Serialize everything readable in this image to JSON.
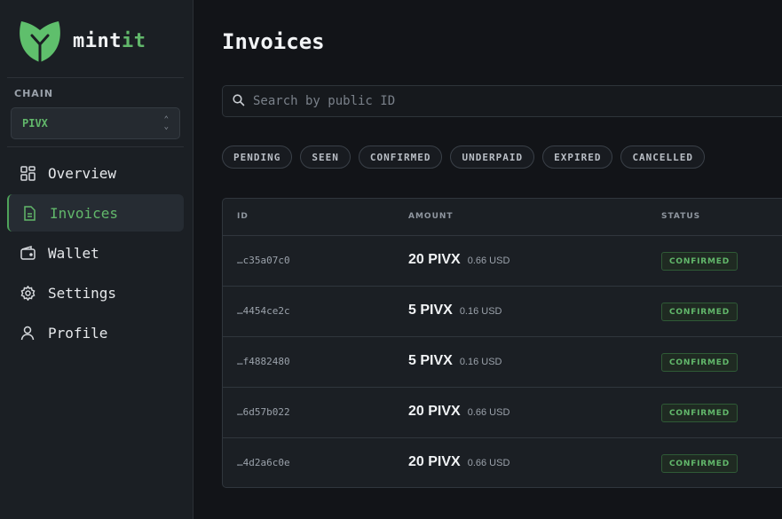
{
  "brand": {
    "name_part1": "mint",
    "name_part2": "it",
    "accent": "#62b86b"
  },
  "sidebar": {
    "chain_label": "CHAIN",
    "chain_value": "PIVX",
    "items": [
      {
        "label": "Overview",
        "icon": "grid-icon",
        "active": false
      },
      {
        "label": "Invoices",
        "icon": "document-icon",
        "active": true
      },
      {
        "label": "Wallet",
        "icon": "wallet-icon",
        "active": false
      },
      {
        "label": "Settings",
        "icon": "gear-icon",
        "active": false
      },
      {
        "label": "Profile",
        "icon": "user-icon",
        "active": false
      }
    ]
  },
  "main": {
    "title": "Invoices",
    "search": {
      "placeholder": "Search by public ID",
      "value": ""
    },
    "filters": [
      "PENDING",
      "SEEN",
      "CONFIRMED",
      "UNDERPAID",
      "EXPIRED",
      "CANCELLED"
    ],
    "table": {
      "columns": [
        "ID",
        "AMOUNT",
        "STATUS"
      ],
      "rows": [
        {
          "id": "…c35a07c0",
          "amount": "20 PIVX",
          "usd": "0.66 USD",
          "status": "CONFIRMED"
        },
        {
          "id": "…4454ce2c",
          "amount": "5 PIVX",
          "usd": "0.16 USD",
          "status": "CONFIRMED"
        },
        {
          "id": "…f4882480",
          "amount": "5 PIVX",
          "usd": "0.16 USD",
          "status": "CONFIRMED"
        },
        {
          "id": "…6d57b022",
          "amount": "20 PIVX",
          "usd": "0.66 USD",
          "status": "CONFIRMED"
        },
        {
          "id": "…4d2a6c0e",
          "amount": "20 PIVX",
          "usd": "0.66 USD",
          "status": "CONFIRMED"
        }
      ]
    }
  }
}
